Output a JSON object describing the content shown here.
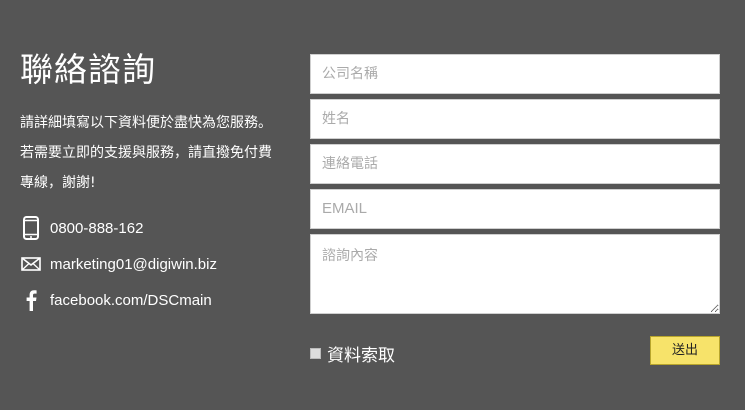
{
  "heading": "聯絡諮詢",
  "description": {
    "line1": "請詳細填寫以下資料便於盡快為您服務。",
    "line2": "若需要立即的支援與服務，請直撥免付費",
    "line3": "專線，謝謝!"
  },
  "contacts": [
    {
      "icon": "phone-icon",
      "text": "0800-888-162"
    },
    {
      "icon": "mail-icon",
      "text": "marketing01@digiwin.biz"
    },
    {
      "icon": "facebook-icon",
      "text": "facebook.com/DSCmain"
    }
  ],
  "form": {
    "company_placeholder": "公司名稱",
    "name_placeholder": "姓名",
    "phone_placeholder": "連絡電話",
    "email_placeholder": "EMAIL",
    "message_placeholder": "諮詢內容"
  },
  "policy_label": "資料索取",
  "submit_label": "送出"
}
